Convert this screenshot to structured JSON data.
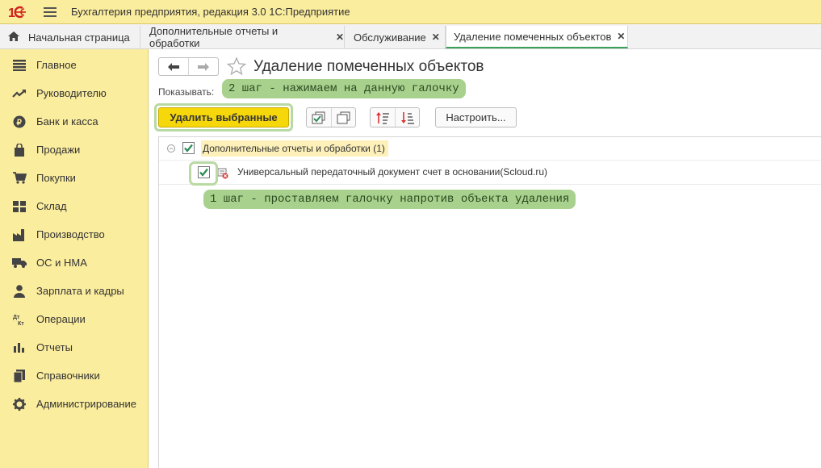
{
  "app": {
    "title": "Бухгалтерия предприятия, редакция 3.0 1С:Предприятие"
  },
  "tabs": [
    {
      "label": "Начальная страница"
    },
    {
      "label": "Дополнительные отчеты и обработки"
    },
    {
      "label": "Обслуживание"
    },
    {
      "label": "Удаление помеченных объектов"
    }
  ],
  "sidebar": {
    "items": [
      {
        "label": "Главное",
        "icon": "list-icon"
      },
      {
        "label": "Руководителю",
        "icon": "trend-icon"
      },
      {
        "label": "Банк и касса",
        "icon": "ruble-icon"
      },
      {
        "label": "Продажи",
        "icon": "bag-icon"
      },
      {
        "label": "Покупки",
        "icon": "cart-icon"
      },
      {
        "label": "Склад",
        "icon": "warehouse-icon"
      },
      {
        "label": "Производство",
        "icon": "factory-icon"
      },
      {
        "label": "ОС и НМА",
        "icon": "truck-icon"
      },
      {
        "label": "Зарплата и кадры",
        "icon": "person-icon"
      },
      {
        "label": "Операции",
        "icon": "dt-kt-icon"
      },
      {
        "label": "Отчеты",
        "icon": "bar-chart-icon"
      },
      {
        "label": "Справочники",
        "icon": "book-icon"
      },
      {
        "label": "Администрирование",
        "icon": "gear-icon"
      }
    ]
  },
  "page": {
    "title": "Удаление помеченных объектов",
    "show_label": "Показывать:",
    "delete_button": "Удалить выбранные",
    "settings_button": "Настроить..."
  },
  "annotations": {
    "step2": "2 шаг - нажимаем на данную галочку",
    "step1": "1 шаг - проставляем галочку напротив объекта удаления"
  },
  "tree": {
    "group": {
      "label": "Дополнительные отчеты и обработки (1)",
      "checked": true
    },
    "item": {
      "label": "Универсальный передаточный документ счет в основании(Scloud.ru)",
      "checked": true
    }
  },
  "colors": {
    "accent_yellow": "#fbed9e",
    "button_yellow": "#f6d80a",
    "check_green": "#2e8b57",
    "annotation_green": "#a9d18e"
  }
}
